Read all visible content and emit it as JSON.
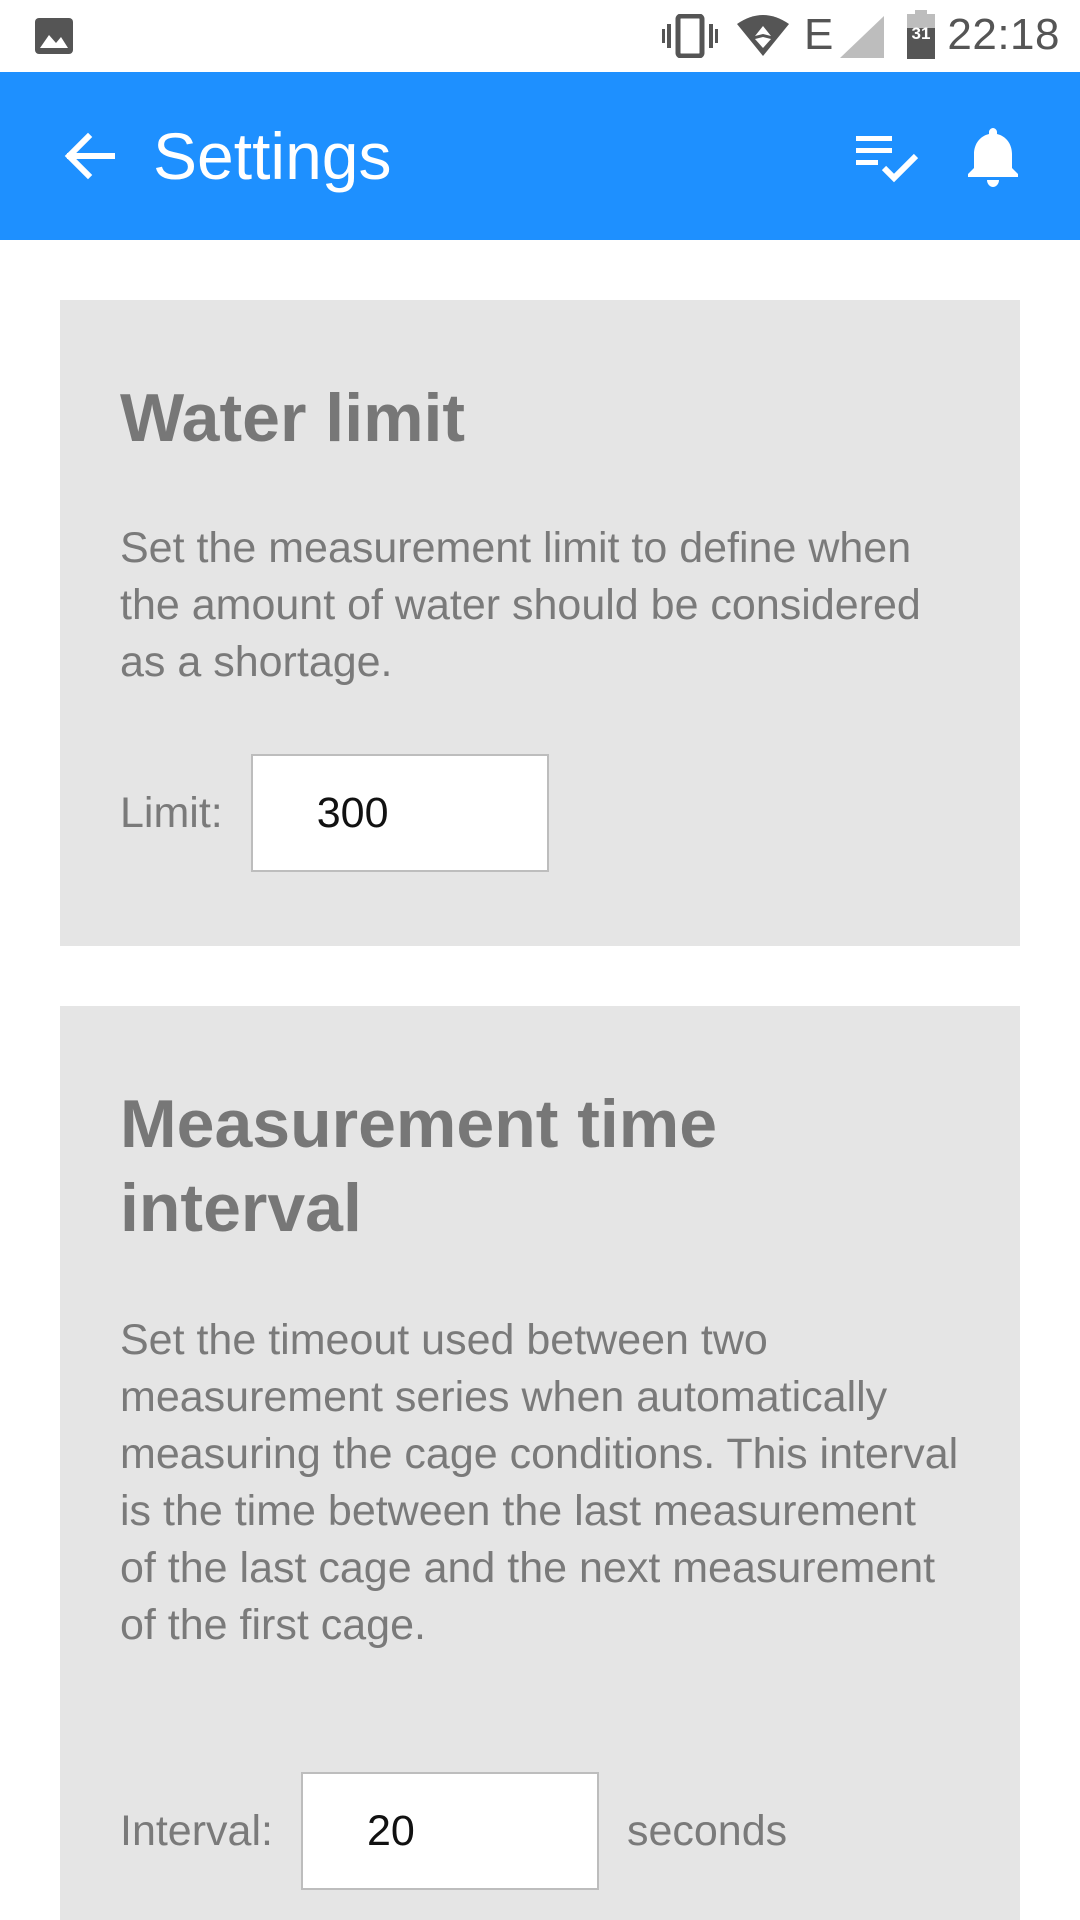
{
  "status_bar": {
    "time": "22:18",
    "network": "E",
    "battery_level": "31",
    "icons": [
      "image-icon",
      "vibrate-icon",
      "wifi-icon",
      "signal-icon",
      "battery-icon"
    ]
  },
  "app_bar": {
    "title": "Settings",
    "back_icon": "arrow-back-icon",
    "actions": [
      "playlist-check-icon",
      "bell-icon"
    ],
    "color": "#1e90ff"
  },
  "water_limit": {
    "title": "Water limit",
    "description": "Set the measurement limit to define when the amount of water should be considered as a shortage.",
    "field_label": "Limit:",
    "field_value": "300"
  },
  "measurement_interval": {
    "title": "Measurement time interval",
    "description": "Set the timeout used between two measurement series when automatically measuring the cage conditions. This interval is the time between the last measurement of the last cage and the next measurement of the first cage.",
    "field_label": "Interval:",
    "field_value": "20",
    "field_suffix": "seconds"
  },
  "colors": {
    "card_background": "#e5e5e5",
    "text_gray": "#7a7a7a"
  }
}
